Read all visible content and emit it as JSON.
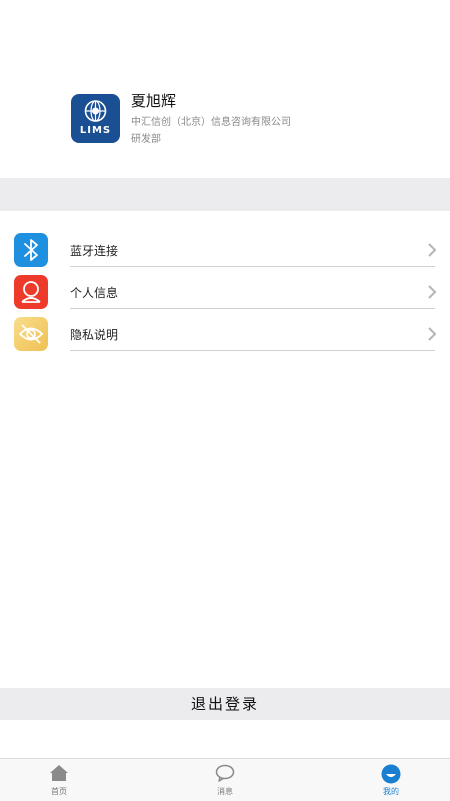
{
  "profile": {
    "avatar_text": "LIMS",
    "name": "夏旭辉",
    "company": "中汇信创（北京）信息咨询有限公司",
    "department": "研发部"
  },
  "menu": {
    "items": [
      {
        "label": "蓝牙连接",
        "icon": "bluetooth-icon",
        "color": "#1f8fe0"
      },
      {
        "label": "个人信息",
        "icon": "person-icon",
        "color": "#ee3a2a"
      },
      {
        "label": "隐私说明",
        "icon": "eye-slash-icon",
        "color": "#f3cd6a"
      }
    ]
  },
  "logout_label": "退出登录",
  "tabbar": {
    "tabs": [
      {
        "label": "首页",
        "icon": "home-icon",
        "active": false
      },
      {
        "label": "消息",
        "icon": "message-icon",
        "active": false
      },
      {
        "label": "我的",
        "icon": "profile-icon",
        "active": true
      }
    ],
    "active_color": "#1a7fd0"
  }
}
